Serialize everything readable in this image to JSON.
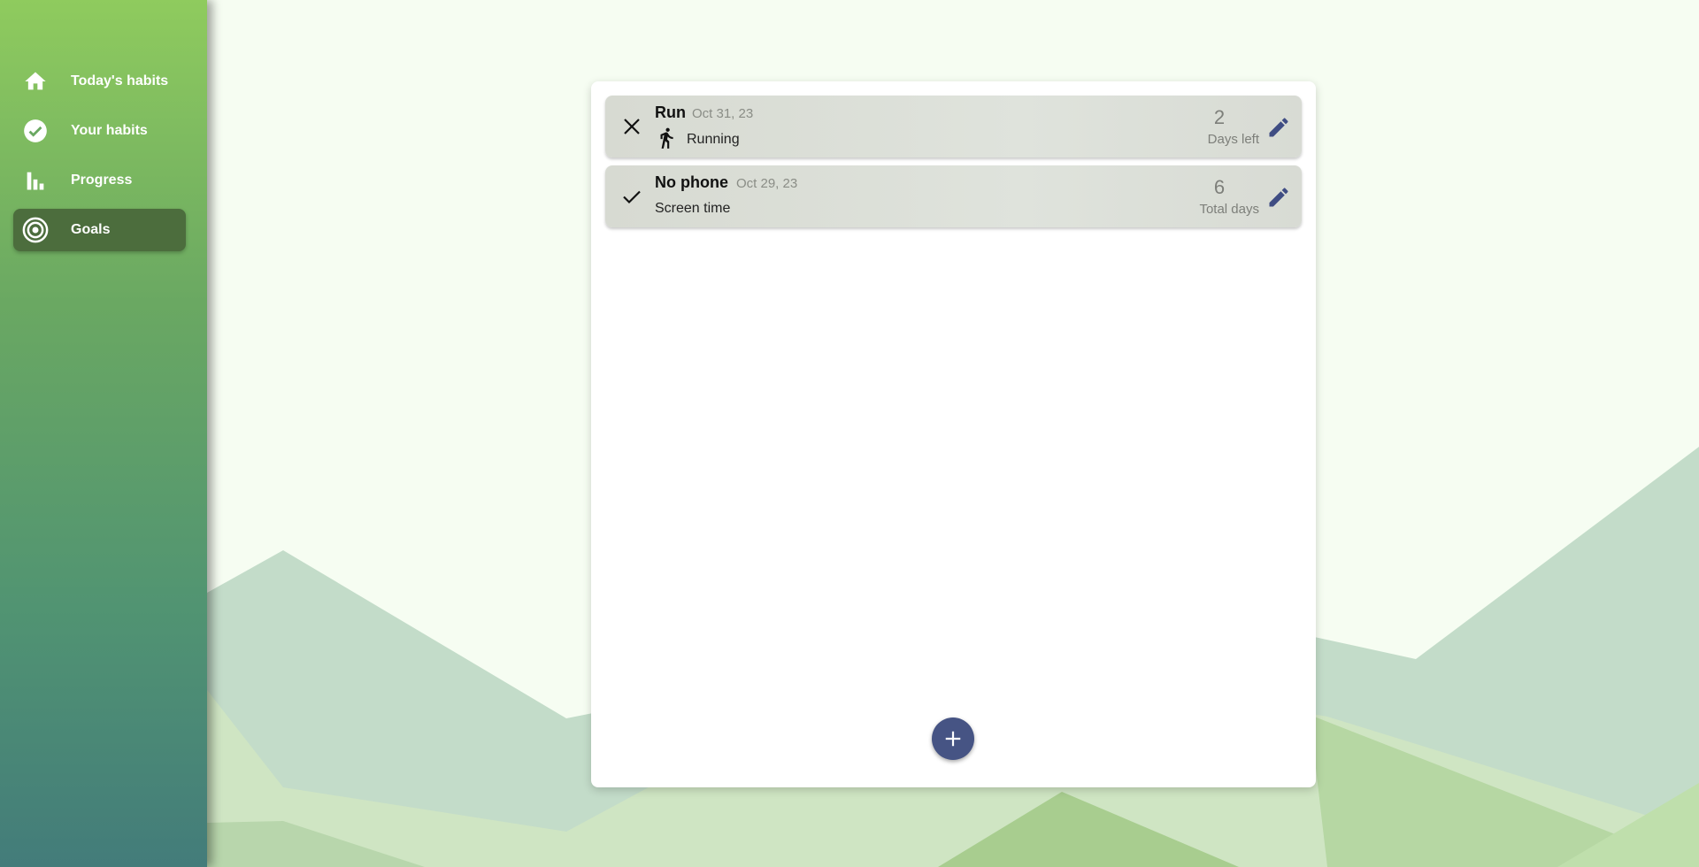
{
  "nav": {
    "items": [
      {
        "label": "Today's habits",
        "icon": "home-icon",
        "active": false
      },
      {
        "label": "Your habits",
        "icon": "check-circle-icon",
        "active": false
      },
      {
        "label": "Progress",
        "icon": "bar-chart-icon",
        "active": false
      },
      {
        "label": "Goals",
        "icon": "target-icon",
        "active": true
      }
    ]
  },
  "goals": [
    {
      "name": "Run",
      "date": "Oct 31, 23",
      "category": "Running",
      "category_icon": "running-person-icon",
      "status_icon": "close-icon",
      "count": "2",
      "count_label": "Days left"
    },
    {
      "name": "No phone",
      "date": "Oct 29, 23",
      "category": "Screen time",
      "status_icon": "checkmark-icon",
      "count": "6",
      "count_label": "Total days"
    }
  ],
  "colors": {
    "accent": "#465484",
    "sidebar_active": "#4c6d3d",
    "sidebar_top": "#8fcb5e",
    "sidebar_bottom": "#437c7a"
  }
}
